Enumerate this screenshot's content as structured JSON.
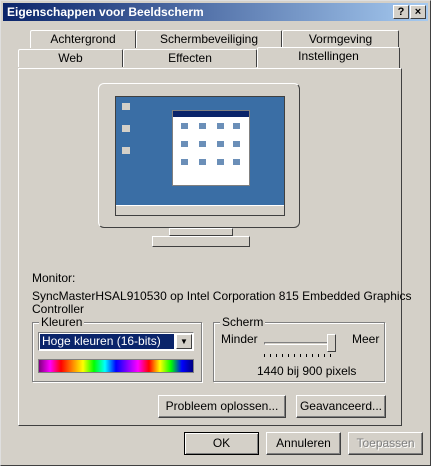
{
  "window": {
    "title": "Eigenschappen voor Beeldscherm"
  },
  "title_buttons": {
    "help": "?",
    "close": "×"
  },
  "tabs_back": [
    "Achtergrond",
    "Schermbeveiliging",
    "Vormgeving"
  ],
  "tabs_front": [
    "Web",
    "Effecten",
    "Instellingen"
  ],
  "active_tab": "Instellingen",
  "monitor": {
    "label": "Monitor:",
    "description_line1": "SyncMasterHSAL910530 op Intel Corporation 815 Embedded Graphics",
    "description_line2": "Controller"
  },
  "colors_group": {
    "label": "Kleuren",
    "selected": "Hoge kleuren (16-bits)"
  },
  "screen_group": {
    "label": "Scherm",
    "min_label": "Minder",
    "max_label": "Meer",
    "resolution": "1440 bij 900 pixels",
    "slider_fraction": 1.0
  },
  "buttons": {
    "troubleshoot": "Probleem oplossen...",
    "advanced": "Geavanceerd...",
    "ok": "OK",
    "cancel": "Annuleren",
    "apply": "Toepassen"
  },
  "colors": {
    "title_start": "#0a246a",
    "title_end": "#a6caf0",
    "desktop": "#3a6ea5",
    "select_highlight": "#0a246a"
  }
}
